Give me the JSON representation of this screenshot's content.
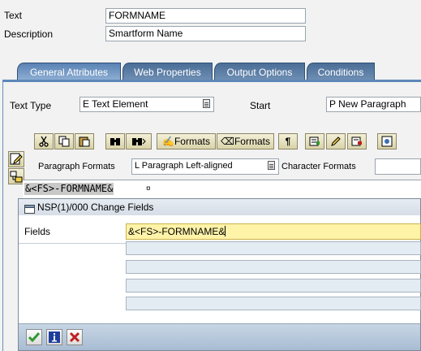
{
  "header": {
    "text_label": "Text",
    "text_value": "FORMNAME",
    "description_label": "Description",
    "description_value": "Smartform Name"
  },
  "tabs": [
    {
      "label": "General Attributes",
      "active": true
    },
    {
      "label": "Web Properties",
      "active": false
    },
    {
      "label": "Output Options",
      "active": false
    },
    {
      "label": "Conditions",
      "active": false
    }
  ],
  "general": {
    "text_type_label": "Text Type",
    "text_type_value": "E Text Element",
    "start_label": "Start",
    "start_value": "P New Paragraph"
  },
  "toolbar": {
    "formats_label_1": "Formats",
    "formats_label_2": "Formats",
    "paragraph_mark": "¶"
  },
  "formats": {
    "paragraph_formats_label": "Paragraph Formats",
    "paragraph_formats_value": "L Paragraph Left-aligned",
    "character_formats_label": "Character Formats",
    "character_formats_value": ""
  },
  "editor": {
    "line_text": "&<FS>-FORMNAME&",
    "end_mark": "¤"
  },
  "popup": {
    "title": "NSP(1)/000 Change Fields",
    "fields_label": "Fields",
    "field_value": "&<FS>-FORMNAME&"
  },
  "colors": {
    "tab_blue": "#4b6e96",
    "highlight_yellow": "#fff3a8",
    "confirm_green": "#2f9a2f",
    "cancel_red": "#c0201e"
  }
}
